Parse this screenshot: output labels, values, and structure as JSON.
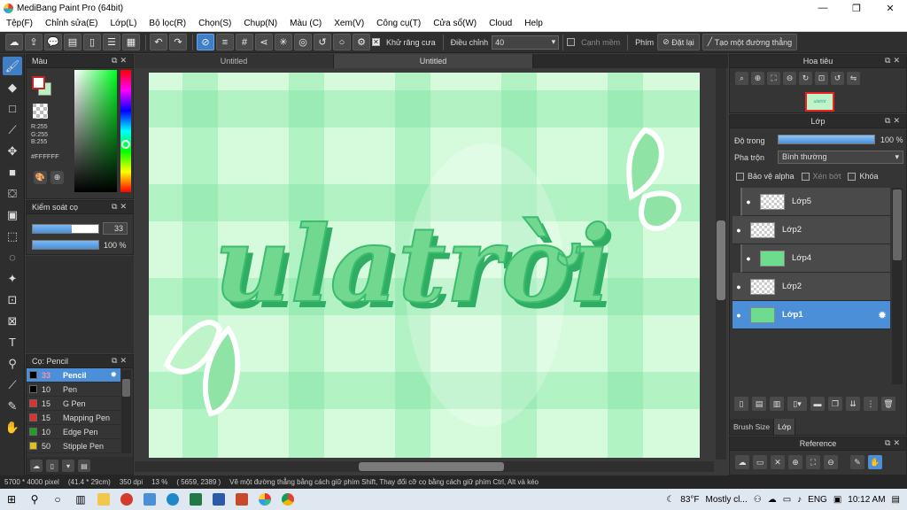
{
  "window": {
    "title": "MediBang Paint Pro (64bit)",
    "controls": [
      "—",
      "❐",
      "✕"
    ]
  },
  "menu": [
    "Tệp(F)",
    "Chỉnh sửa(E)",
    "Lớp(L)",
    "Bộ lọc(R)",
    "Chọn(S)",
    "Chụp(N)",
    "Màu (C)",
    "Xem(V)",
    "Công cụ(T)",
    "Cửa sổ(W)",
    "Cloud",
    "Help"
  ],
  "toolbar": {
    "antialias_label": "Khử răng cưa",
    "adjust_label": "Điều chỉnh",
    "adjust_value": "40",
    "edge_label": "Cạnh mềm",
    "key_label": "Phím",
    "reset_label": "Đặt lại",
    "line_label": "Tạo một đường thẳng"
  },
  "color_panel": {
    "title": "Màu",
    "rgb": [
      "R:255",
      "G:255",
      "B:255"
    ],
    "hex": "#FFFFFF",
    "fg_color": "#FFFFFF",
    "bg_color": "#B9F0C1"
  },
  "brush_control": {
    "title": "Kiểm soát cọ",
    "size": "33",
    "size_fraction": 0.6,
    "opacity": "100 %",
    "opacity_fraction": 1.0
  },
  "brush_list": {
    "title": "Cọ: Pencil",
    "items": [
      {
        "size": "33",
        "name": "Pencil",
        "color": "#000000"
      },
      {
        "size": "10",
        "name": "Pen",
        "color": "#000000"
      },
      {
        "size": "15",
        "name": "G Pen",
        "color": "#e03030"
      },
      {
        "size": "15",
        "name": "Mapping Pen",
        "color": "#e03030"
      },
      {
        "size": "10",
        "name": "Edge Pen",
        "color": "#20a020"
      },
      {
        "size": "50",
        "name": "Stipple Pen",
        "color": "#e0c020"
      }
    ]
  },
  "doc_tabs": [
    "Untitled",
    "Untitled"
  ],
  "artwork": {
    "lettering": "ulatrời"
  },
  "navigator": {
    "title": "Hoa tiêu",
    "thumb_text": "ulatrời"
  },
  "layers": {
    "title": "Lớp",
    "opacity_label": "Độ trong",
    "opacity_value": "100 %",
    "opacity_fraction": 1.0,
    "blend_label": "Pha trộn",
    "blend_value": "Bình thường",
    "protect_alpha": "Bảo vệ alpha",
    "clip": "Xén bớt",
    "lock": "Khóa",
    "items": [
      {
        "name": "Lớp5"
      },
      {
        "name": "Lớp2"
      },
      {
        "name": "Lớp4"
      },
      {
        "name": "Lớp2"
      },
      {
        "name": "Lớp1"
      }
    ],
    "tabs": [
      "Brush Size",
      "Lớp"
    ]
  },
  "reference": {
    "title": "Reference"
  },
  "status": {
    "size": "5700 * 4000 pixel",
    "cm": "(41.4 * 29cm)",
    "dpi": "350 dpi",
    "zoom": "13 %",
    "coords": "( 5659, 2389 )",
    "hint": "Vẽ một đường thẳng bằng cách giữ phím Shift, Thay đổi cỡ cọ bằng cách giữ phím Ctrl, Alt và kéo"
  },
  "taskbar": {
    "temp": "83°F",
    "weather": "Mostly cl...",
    "lang": "ENG",
    "time": "10:12 AM"
  }
}
